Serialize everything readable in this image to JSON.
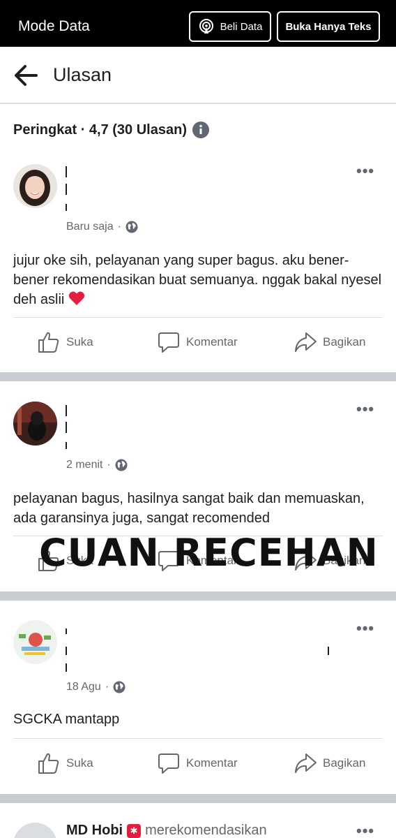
{
  "topbar": {
    "mode_label": "Mode Data",
    "buy_data_label": "Beli Data",
    "text_only_label": "Buka Hanya Teks"
  },
  "header": {
    "title": "Ulasan"
  },
  "rating": {
    "text": "Peringkat · 4,7 (30 Ulasan)"
  },
  "actions": {
    "like": "Suka",
    "comment": "Komentar",
    "share": "Bagikan"
  },
  "reviews": [
    {
      "time": "Baru saja",
      "text": "jujur oke sih, pelayanan yang super bagus. aku bener-bener rekomendasikan buat semuanya. nggak bakal nyesel deh aslii",
      "emoji": "❤️"
    },
    {
      "time": "2 menit",
      "text": "pelayanan bagus, hasilnya sangat baik dan memuaskan, ada garansinya juga, sangat recomended"
    },
    {
      "time": "18 Agu",
      "text": "SGCKA mantapp"
    },
    {
      "author": "MD Hobi",
      "recommends": "merekomendasikan"
    }
  ],
  "watermark": "CUAN RECEHAN",
  "colors": {
    "topbar": "#000000",
    "separator": "#c9ccd1",
    "muted": "#65676b",
    "heart": "#e41e3f"
  }
}
